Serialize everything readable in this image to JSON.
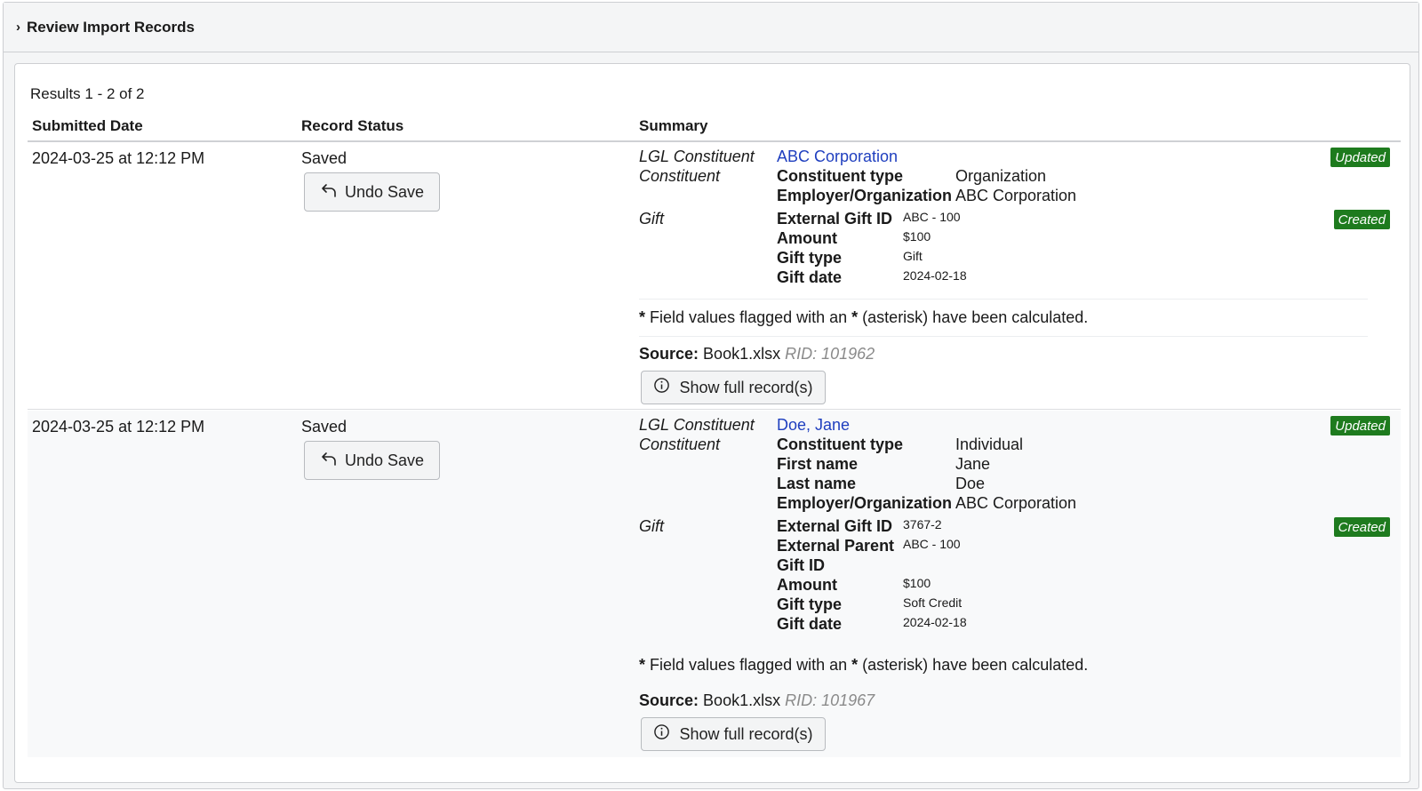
{
  "header": {
    "chevron": "›",
    "title": "Review Import Records"
  },
  "results_text": "Results 1 - 2 of 2",
  "columns": {
    "date": "Submitted Date",
    "status": "Record Status",
    "summary": "Summary"
  },
  "note": {
    "star": "*",
    "text_before": " Field values flagged with an ",
    "text_after": " (asterisk) have been calculated."
  },
  "labels": {
    "lgl_constituent": "LGL Constituent",
    "constituent": "Constituent",
    "gift": "Gift",
    "source": "Source:",
    "undo": "Undo Save",
    "show_full": "Show full record(s)"
  },
  "badge_colors": {
    "updated": "#1e7b1e",
    "created": "#1e7b1e"
  },
  "link_color": "#1f3fbf",
  "records": [
    {
      "date": "2024-03-25 at 12:12 PM",
      "status": "Saved",
      "constituent_name": "ABC Corporation",
      "constituent_badge": "Updated",
      "constituent_fields": [
        {
          "name": "Constituent type",
          "value": "Organization"
        },
        {
          "name": "Employer/Organization",
          "value": "ABC Corporation"
        }
      ],
      "gift_badge": "Created",
      "gift_fields": [
        {
          "name": "External Gift ID",
          "value": "ABC - 100"
        },
        {
          "name": "Amount",
          "value": "$100"
        },
        {
          "name": "Gift type",
          "value": "Gift"
        },
        {
          "name": "Gift date",
          "value": "2024-02-18"
        }
      ],
      "source_file": "Book1.xlsx",
      "rid": "RID: 101962"
    },
    {
      "date": "2024-03-25 at 12:12 PM",
      "status": "Saved",
      "constituent_name": "Doe, Jane",
      "constituent_badge": "Updated",
      "constituent_fields": [
        {
          "name": "Constituent type",
          "value": "Individual"
        },
        {
          "name": "First name",
          "value": "Jane"
        },
        {
          "name": "Last name",
          "value": "Doe"
        },
        {
          "name": "Employer/Organization",
          "value": "ABC Corporation"
        }
      ],
      "gift_badge": "Created",
      "gift_fields": [
        {
          "name": "External Gift ID",
          "value": "3767-2"
        },
        {
          "name": "External Parent",
          "value": "ABC - 100"
        },
        {
          "name": "Gift ID",
          "value": ""
        },
        {
          "name": "Amount",
          "value": "$100"
        },
        {
          "name": "Gift type",
          "value": "Soft Credit"
        },
        {
          "name": "Gift date",
          "value": "2024-02-18"
        }
      ],
      "source_file": "Book1.xlsx",
      "rid": "RID: 101967"
    }
  ],
  "icons": {
    "undo": "undo-arrow-icon",
    "info": "info-circle-icon"
  }
}
